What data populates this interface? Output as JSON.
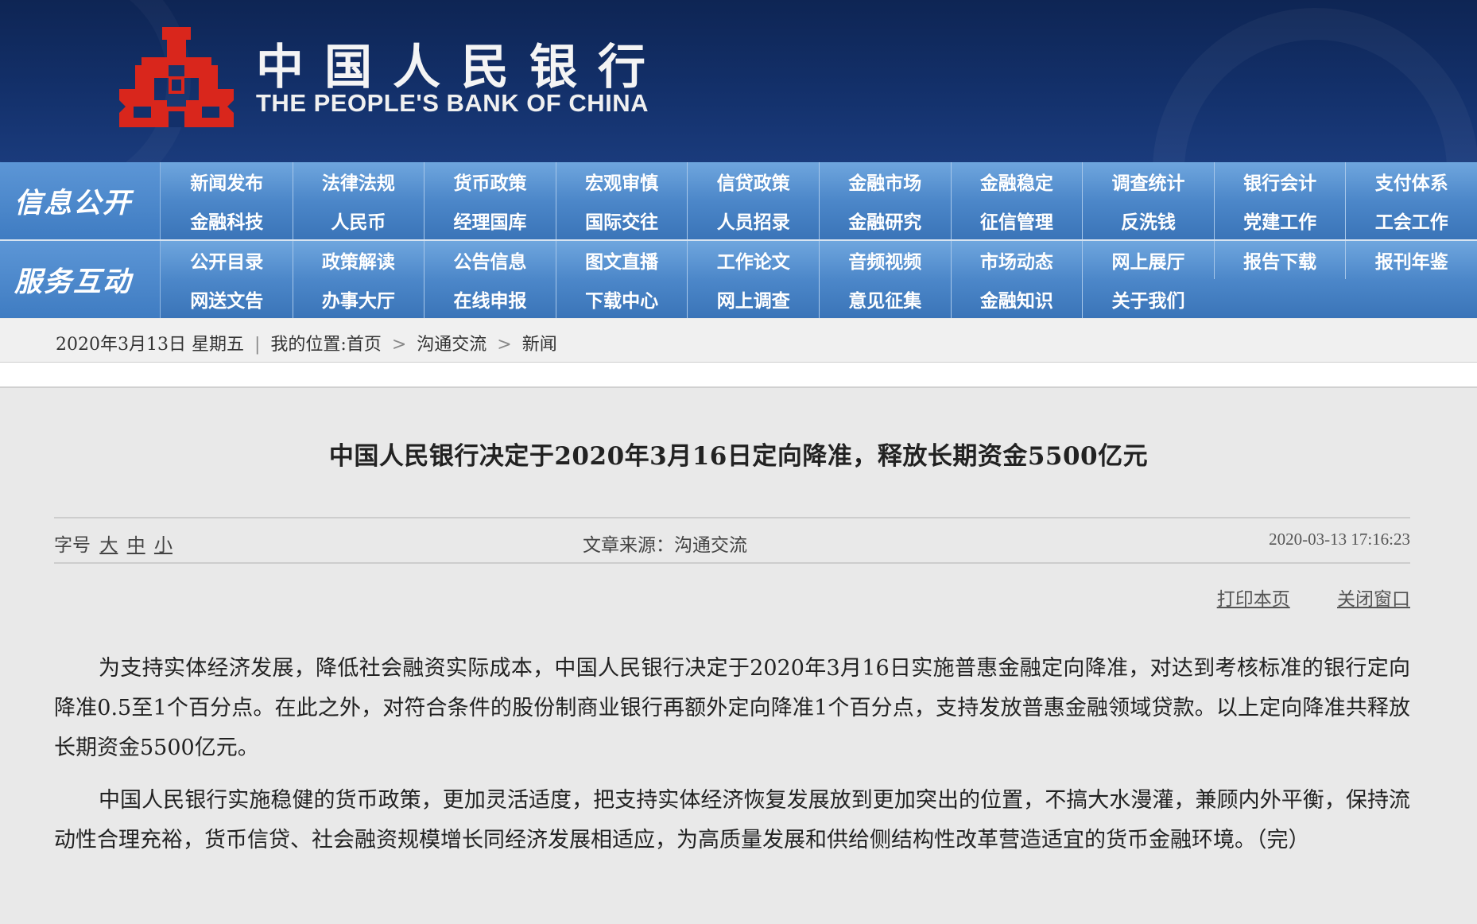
{
  "header": {
    "bank_name_cn": "中国人民银行",
    "bank_name_en": "THE PEOPLE'S BANK OF CHINA",
    "logo_icon": "pboc-emblem-icon",
    "colors": {
      "banner": "#13306a",
      "logo": "#d9261c",
      "nav": "#4c87c9"
    }
  },
  "nav": {
    "section1": {
      "label": "信息公开",
      "items": [
        "新闻发布",
        "法律法规",
        "货币政策",
        "宏观审慎",
        "信贷政策",
        "金融市场",
        "金融稳定",
        "调查统计",
        "银行会计",
        "支付体系",
        "金融科技",
        "人民币",
        "经理国库",
        "国际交往",
        "人员招录",
        "金融研究",
        "征信管理",
        "反洗钱",
        "党建工作",
        "工会工作"
      ]
    },
    "section2": {
      "label": "服务互动",
      "items": [
        "公开目录",
        "政策解读",
        "公告信息",
        "图文直播",
        "工作论文",
        "音频视频",
        "市场动态",
        "网上展厅",
        "报告下载",
        "报刊年鉴",
        "网送文告",
        "办事大厅",
        "在线申报",
        "下载中心",
        "网上调查",
        "意见征集",
        "金融知识",
        "关于我们"
      ]
    }
  },
  "breadcrumb": {
    "date": "2020年3月13日 星期五",
    "divider": "|",
    "location_label": "我的位置:",
    "home": "首页",
    "arrow": ">",
    "level1": "沟通交流",
    "level2": "新闻"
  },
  "article": {
    "title": "中国人民银行决定于2020年3月16日定向降准，释放长期资金5500亿元",
    "font_size_label": "字号",
    "font_large": "大",
    "font_medium": "中",
    "font_small": "小",
    "source": "文章来源：沟通交流",
    "datetime": "2020-03-13 17:16:23",
    "print_label": "打印本页",
    "close_label": "关闭窗口",
    "paragraphs": [
      "为支持实体经济发展，降低社会融资实际成本，中国人民银行决定于2020年3月16日实施普惠金融定向降准，对达到考核标准的银行定向降准0.5至1个百分点。在此之外，对符合条件的股份制商业银行再额外定向降准1个百分点，支持发放普惠金融领域贷款。以上定向降准共释放长期资金5500亿元。",
      "中国人民银行实施稳健的货币政策，更加灵活适度，把支持实体经济恢复发展放到更加突出的位置，不搞大水漫灌，兼顾内外平衡，保持流动性合理充裕，货币信贷、社会融资规模增长同经济发展相适应，为高质量发展和供给侧结构性改革营造适宜的货币金融环境。（完）"
    ]
  }
}
